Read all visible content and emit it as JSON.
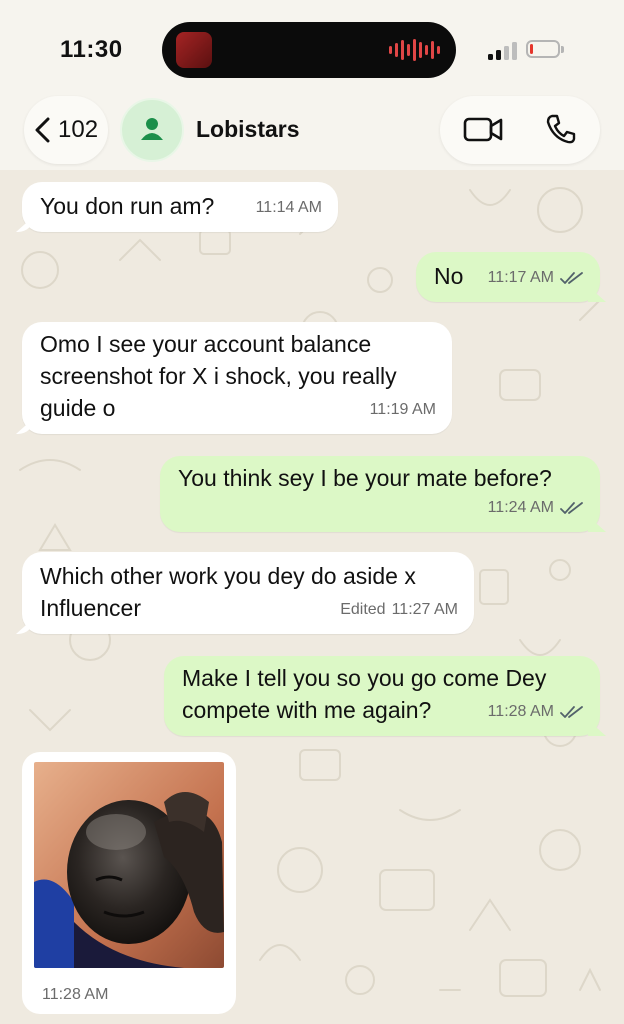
{
  "status_bar": {
    "time": "11:30",
    "battery_level": 0.12,
    "battery_color": "#e5352b",
    "signal_bars_filled": 2,
    "signal_bars_total": 4
  },
  "header": {
    "back_count": "102",
    "back_icon": "chevron-left-icon",
    "contact_name": "Lobistars",
    "avatar_icon": "person-icon",
    "video_call_icon": "video-camera-icon",
    "voice_call_icon": "phone-icon",
    "accent": "#1b8f4a"
  },
  "messages": [
    {
      "direction": "in",
      "text": "You don run am?",
      "time": "11:14 AM"
    },
    {
      "direction": "out",
      "text": "No",
      "time": "11:17 AM",
      "read": true
    },
    {
      "direction": "in",
      "text": "Omo I see your account balance screenshot for X i shock, you really guide o",
      "time": "11:19 AM"
    },
    {
      "direction": "out",
      "text": "You think sey I be your mate before?",
      "time": "11:24 AM",
      "read": true
    },
    {
      "direction": "in",
      "text": "Which other work you dey do aside x Influencer",
      "edited_label": "Edited",
      "time": "11:27 AM"
    },
    {
      "direction": "out",
      "text": "Make I tell you so you go come Dey compete with me again?",
      "time": "11:28 AM",
      "read": true
    },
    {
      "direction": "in",
      "type": "image",
      "time": "11:28 AM"
    }
  ],
  "colors": {
    "incoming_bubble": "#ffffff",
    "outgoing_bubble": "#dcf8c6",
    "read_ticks": "#53626b",
    "wallpaper": "#efeae0"
  }
}
